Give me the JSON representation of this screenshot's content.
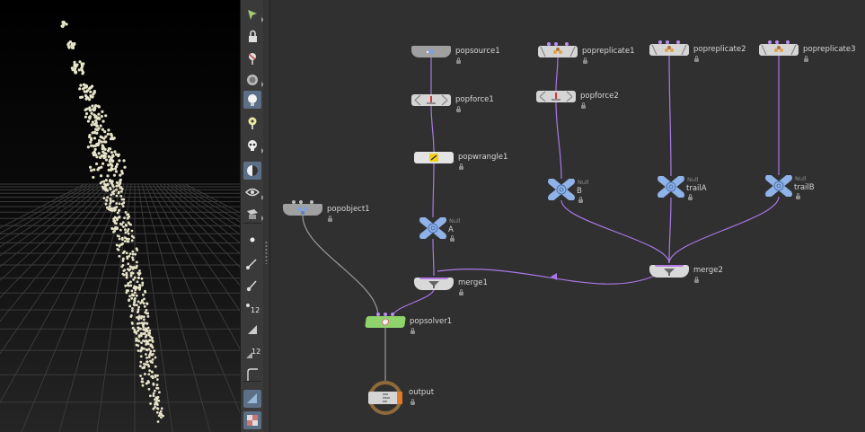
{
  "app": {
    "accent_color": "#9a67e0",
    "wire_color_particles": "#a978e6",
    "wire_color_default": "#9c9c9c",
    "network_bg": "#303030",
    "viewport_bg_top": "#000000",
    "viewport_bg_bottom": "#202020"
  },
  "viewport": {
    "content": "particle stream of pale dots over perspective ground grid",
    "particle_color": "#e6e3c8",
    "grid_color": "#3a3a3a"
  },
  "toolbar": {
    "tools": [
      {
        "name": "select-icon",
        "selected": false
      },
      {
        "name": "lock-icon",
        "selected": false
      },
      {
        "name": "pin-icon",
        "selected": false
      },
      {
        "name": "camera-view-icon",
        "selected": false
      },
      {
        "name": "light-bulb-icon",
        "selected": true
      },
      {
        "name": "headlight-icon",
        "selected": false
      },
      {
        "name": "skull-ghost-icon",
        "selected": false
      },
      {
        "name": "shading-mode-icon",
        "selected": true
      },
      {
        "name": "visibility-eye-icon",
        "selected": false
      },
      {
        "name": "display-options-icon",
        "selected": false
      },
      {
        "name": "point-display-icon",
        "selected": false
      },
      {
        "name": "normal-display-icon",
        "selected": false
      },
      {
        "name": "point-normals-icon",
        "selected": false
      },
      {
        "name": "point-numbers-icon",
        "selected": false,
        "label": "12"
      },
      {
        "name": "prim-display-icon",
        "selected": false
      },
      {
        "name": "prim-numbers-icon",
        "selected": false,
        "label": "12"
      },
      {
        "name": "hull-display-icon",
        "selected": false
      },
      {
        "name": "ortho-grid-icon",
        "selected": true
      },
      {
        "name": "background-checker-icon",
        "selected": true
      }
    ]
  },
  "network": {
    "nodes": [
      {
        "id": "popsource1",
        "label": "popsource1",
        "type": "",
        "kind": "source"
      },
      {
        "id": "popforce1",
        "label": "popforce1",
        "type": "",
        "kind": "force"
      },
      {
        "id": "popwrangle1",
        "label": "popwrangle1",
        "type": "",
        "kind": "wrangle"
      },
      {
        "id": "A",
        "label": "A",
        "type": "Null",
        "kind": "null"
      },
      {
        "id": "popreplicate1",
        "label": "popreplicate1",
        "type": "",
        "kind": "replicate"
      },
      {
        "id": "popforce2",
        "label": "popforce2",
        "type": "",
        "kind": "force"
      },
      {
        "id": "B",
        "label": "B",
        "type": "Null",
        "kind": "null"
      },
      {
        "id": "popreplicate2",
        "label": "popreplicate2",
        "type": "",
        "kind": "replicate"
      },
      {
        "id": "trailA",
        "label": "trailA",
        "type": "Null",
        "kind": "null"
      },
      {
        "id": "popreplicate3",
        "label": "popreplicate3",
        "type": "",
        "kind": "replicate"
      },
      {
        "id": "trailB",
        "label": "trailB",
        "type": "Null",
        "kind": "null"
      },
      {
        "id": "popobject1",
        "label": "popobject1",
        "type": "",
        "kind": "object"
      },
      {
        "id": "merge1",
        "label": "merge1",
        "type": "",
        "kind": "merge"
      },
      {
        "id": "merge2",
        "label": "merge2",
        "type": "",
        "kind": "merge"
      },
      {
        "id": "popsolver1",
        "label": "popsolver1",
        "type": "",
        "kind": "solver"
      },
      {
        "id": "output",
        "label": "output",
        "type": "",
        "kind": "output"
      }
    ]
  }
}
